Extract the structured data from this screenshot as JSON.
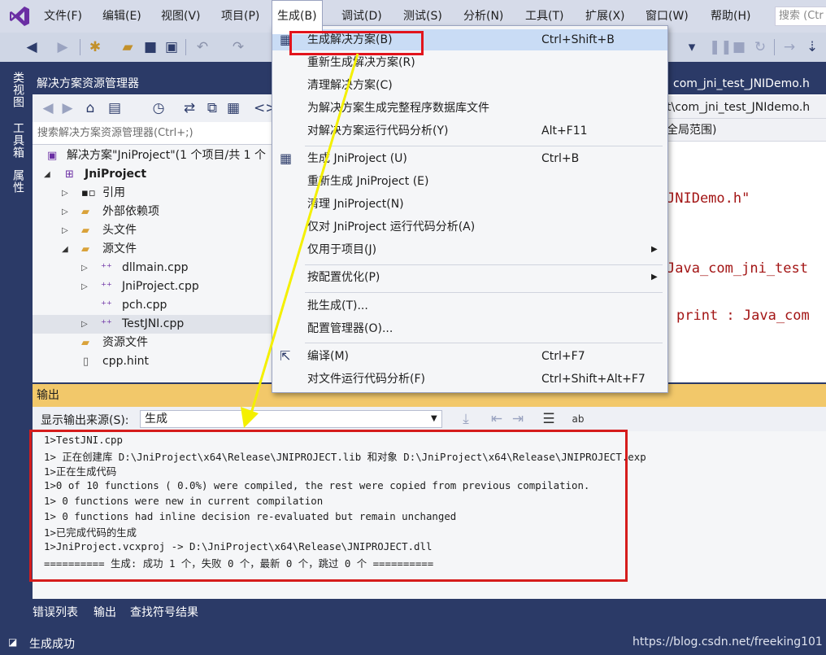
{
  "menubar": {
    "items": [
      "文件(F)",
      "编辑(E)",
      "视图(V)",
      "项目(P)",
      "生成(B)",
      "调试(D)",
      "测试(S)",
      "分析(N)",
      "工具(T)",
      "扩展(X)",
      "窗口(W)",
      "帮助(H)"
    ],
    "search_placeholder": "搜索 (Ctr"
  },
  "left_tabs": [
    "类视图",
    "工具箱",
    "属性"
  ],
  "solution_explorer": {
    "title": "解决方案资源管理器",
    "search_placeholder": "搜索解决方案资源管理器(Ctrl+;)",
    "tree": [
      {
        "label": "解决方案\"JniProject\"(1 个项目/共 1 个",
        "icon": "solution-icon"
      },
      {
        "label": "JniProject",
        "icon": "project-icon"
      },
      {
        "label": "引用",
        "icon": "references-icon"
      },
      {
        "label": "外部依赖项",
        "icon": "external-deps-icon"
      },
      {
        "label": "头文件",
        "icon": "folder-icon"
      },
      {
        "label": "源文件",
        "icon": "folder-open-icon"
      },
      {
        "label": "dllmain.cpp",
        "icon": "cpp-file-icon"
      },
      {
        "label": "JniProject.cpp",
        "icon": "cpp-file-icon"
      },
      {
        "label": "pch.cpp",
        "icon": "cpp-file-icon"
      },
      {
        "label": "TestJNI.cpp",
        "icon": "cpp-file-icon"
      },
      {
        "label": "资源文件",
        "icon": "folder-icon"
      },
      {
        "label": "cpp.hint",
        "icon": "file-icon"
      }
    ]
  },
  "editor": {
    "tab": "com_jni_test_JNIDemo.h",
    "path": "t\\com_jni_test_JNIdemo.h",
    "scope": "全局范围)",
    "code_lines": [
      "JNIDemo.h\"",
      "Java_com_jni_test",
      "print : Java_com"
    ]
  },
  "build_menu": {
    "items": [
      {
        "label": "生成解决方案(B)",
        "shortcut": "Ctrl+Shift+B",
        "icon": "build-solution-icon"
      },
      {
        "label": "重新生成解决方案(R)",
        "shortcut": ""
      },
      {
        "label": "清理解决方案(C)",
        "shortcut": ""
      },
      {
        "label": "为解决方案生成完整程序数据库文件",
        "shortcut": ""
      },
      {
        "label": "对解决方案运行代码分析(Y)",
        "shortcut": "Alt+F11"
      },
      {
        "label": "生成 JniProject (U)",
        "shortcut": "Ctrl+B",
        "icon": "build-project-icon"
      },
      {
        "label": "重新生成 JniProject (E)",
        "shortcut": ""
      },
      {
        "label": "清理 JniProject(N)",
        "shortcut": ""
      },
      {
        "label": "仅对 JniProject 运行代码分析(A)",
        "shortcut": ""
      },
      {
        "label": "仅用于项目(J)",
        "shortcut": ""
      },
      {
        "label": "按配置优化(P)",
        "shortcut": ""
      },
      {
        "label": "批生成(T)...",
        "shortcut": ""
      },
      {
        "label": "配置管理器(O)...",
        "shortcut": ""
      },
      {
        "label": "编译(M)",
        "shortcut": "Ctrl+F7",
        "icon": "compile-icon"
      },
      {
        "label": "对文件运行代码分析(F)",
        "shortcut": "Ctrl+Shift+Alt+F7"
      }
    ]
  },
  "output": {
    "title": "输出",
    "source_label": "显示输出来源(S):",
    "source_value": "生成",
    "lines": [
      "1>TestJNI.cpp",
      "1>  正在创建库 D:\\JniProject\\x64\\Release\\JNIPROJECT.lib 和对象 D:\\JniProject\\x64\\Release\\JNIPROJECT.exp",
      "1>正在生成代码",
      "1>0 of 10 functions ( 0.0%) were compiled, the rest were copied from previous compilation.",
      "1>  0 functions were new in current compilation",
      "1>  0 functions had inline decision re-evaluated but remain unchanged",
      "1>已完成代码的生成",
      "1>JniProject.vcxproj -> D:\\JniProject\\x64\\Release\\JNIPROJECT.dll",
      "========== 生成: 成功 1 个，失败 0 个，最新 0 个，跳过 0 个 =========="
    ]
  },
  "bottom_tabs": [
    "错误列表",
    "输出",
    "查找符号结果"
  ],
  "status": "生成成功",
  "watermark": "https://blog.csdn.net/freeking101",
  "colors": {
    "accent": "#2b3a67",
    "output_title": "#f2c86a",
    "annotation": "#e2141c",
    "arrow": "#f4f000"
  }
}
